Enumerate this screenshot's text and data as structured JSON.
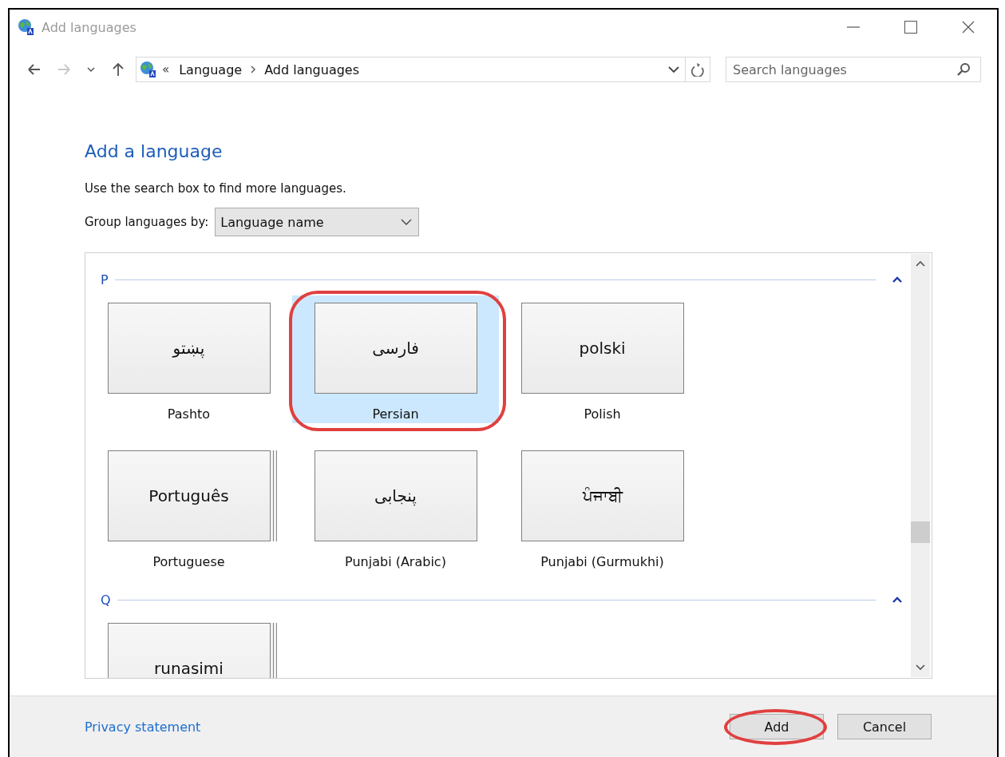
{
  "window": {
    "title": "Add languages"
  },
  "nav_buttons": [
    {
      "kind": "back",
      "disabled": false
    },
    {
      "kind": "forward",
      "disabled": true
    },
    {
      "kind": "recent",
      "disabled": false
    },
    {
      "kind": "up",
      "disabled": false
    }
  ],
  "address_bar": {
    "prefix": "«",
    "breadcrumbs": [
      "Language",
      "Add languages"
    ]
  },
  "search": {
    "placeholder": "Search languages"
  },
  "heading": "Add a language",
  "hint": "Use the search box to find more languages.",
  "group_by": {
    "label": "Group languages by:",
    "value": "Language name"
  },
  "groups": [
    {
      "letter": "P",
      "expanded": true,
      "languages": [
        {
          "native": "پښتو",
          "name": "Pashto",
          "selected": false,
          "stacked": false,
          "annotated": false
        },
        {
          "native": "فارسی",
          "name": "Persian",
          "selected": true,
          "stacked": false,
          "annotated": true
        },
        {
          "native": "polski",
          "name": "Polish",
          "selected": false,
          "stacked": false,
          "annotated": false
        },
        {
          "native": "Português",
          "name": "Portuguese",
          "selected": false,
          "stacked": true,
          "annotated": false
        },
        {
          "native": "پنجابی",
          "name": "Punjabi (Arabic)",
          "selected": false,
          "stacked": false,
          "annotated": false
        },
        {
          "native": "ਪੰਜਾਬੀ",
          "name": "Punjabi (Gurmukhi)",
          "selected": false,
          "stacked": false,
          "annotated": false
        }
      ]
    },
    {
      "letter": "Q",
      "expanded": true,
      "languages": [
        {
          "native": "runasimi",
          "selected": false,
          "stacked": true,
          "annotated": false
        }
      ]
    }
  ],
  "footer": {
    "link": "Privacy statement",
    "buttons": [
      {
        "label": "Add",
        "annotated": true
      },
      {
        "label": "Cancel",
        "annotated": false
      }
    ]
  }
}
